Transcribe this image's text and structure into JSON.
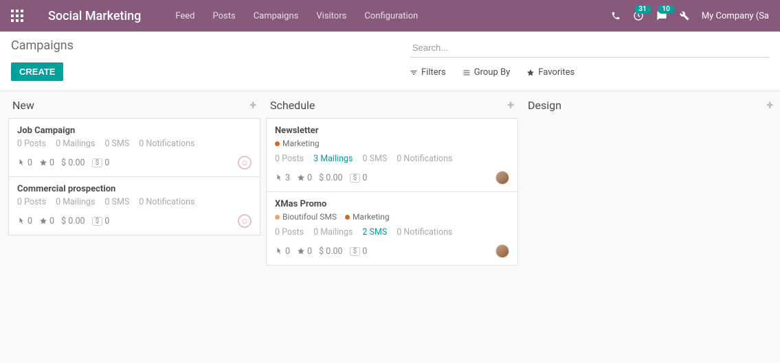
{
  "navbar": {
    "brand": "Social Marketing",
    "menu": [
      "Feed",
      "Posts",
      "Campaigns",
      "Visitors",
      "Configuration"
    ],
    "clock_badge": "31",
    "chat_badge": "10",
    "company": "My Company (Sa"
  },
  "control_panel": {
    "breadcrumb": "Campaigns",
    "create_label": "CREATE",
    "search_placeholder": "Search...",
    "filters_label": "Filters",
    "groupby_label": "Group By",
    "favorites_label": "Favorites"
  },
  "columns": [
    {
      "title": "New",
      "cards": [
        {
          "title": "Job Campaign",
          "tags": [],
          "stats": {
            "posts": "0 Posts",
            "mailings": "0 Mailings",
            "sms": "0 SMS",
            "notifs": "0 Notifications",
            "active": null
          },
          "footer": {
            "clicks": "0",
            "stars": "0",
            "money": "$ 0.00",
            "pill": "0"
          },
          "avatar": "emoji"
        },
        {
          "title": "Commercial prospection",
          "tags": [],
          "stats": {
            "posts": "0 Posts",
            "mailings": "0 Mailings",
            "sms": "0 SMS",
            "notifs": "0 Notifications",
            "active": null
          },
          "footer": {
            "clicks": "0",
            "stars": "0",
            "money": "$ 0.00",
            "pill": "0"
          },
          "avatar": "emoji"
        }
      ]
    },
    {
      "title": "Schedule",
      "cards": [
        {
          "title": "Newsletter",
          "tags": [
            {
              "label": "Marketing",
              "color": "#d2691e"
            }
          ],
          "stats": {
            "posts": "0 Posts",
            "mailings": "3 Mailings",
            "sms": "0 SMS",
            "notifs": "0 Notifications",
            "active": "mailings"
          },
          "footer": {
            "clicks": "3",
            "stars": "0",
            "money": "$ 0.00",
            "pill": "0"
          },
          "avatar": "photo"
        },
        {
          "title": "XMas Promo",
          "tags": [
            {
              "label": "Bioutifoul SMS",
              "color": "#f4a261"
            },
            {
              "label": "Marketing",
              "color": "#d2691e"
            }
          ],
          "stats": {
            "posts": "0 Posts",
            "mailings": "0 Mailings",
            "sms": "2 SMS",
            "notifs": "0 Notifications",
            "active": "sms"
          },
          "footer": {
            "clicks": "0",
            "stars": "0",
            "money": "$ 0.00",
            "pill": "0"
          },
          "avatar": "photo"
        }
      ]
    },
    {
      "title": "Design",
      "cards": []
    }
  ]
}
